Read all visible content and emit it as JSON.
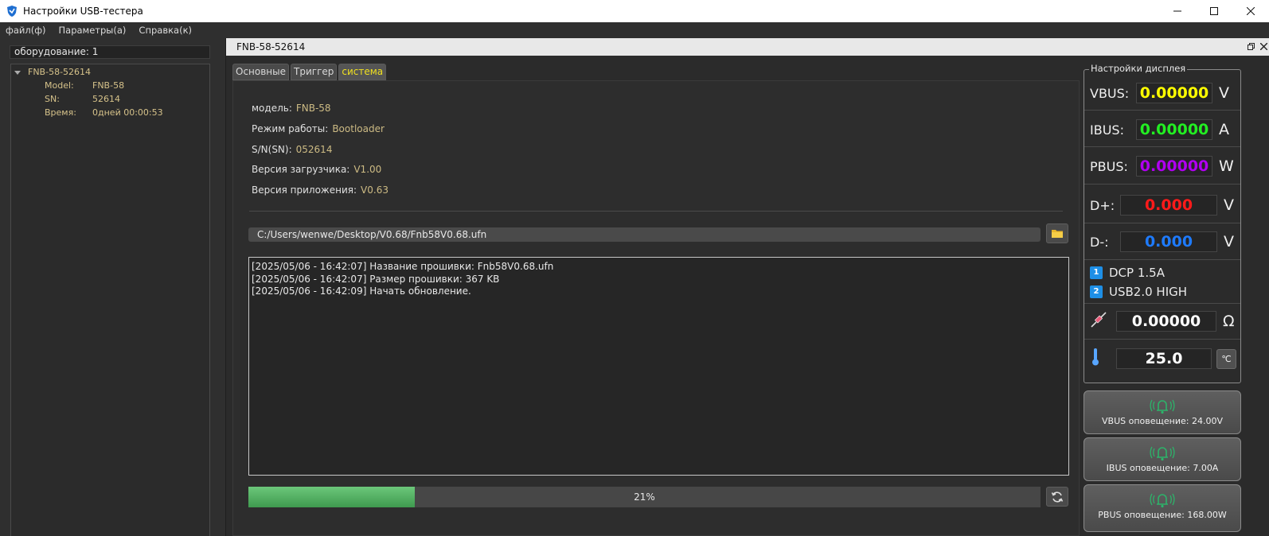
{
  "window": {
    "title": "Настройки USB-тестера"
  },
  "menu": [
    "файл(ф)",
    "Параметры(а)",
    "Справка(к)"
  ],
  "left": {
    "equipment_count": "оборудование: 1",
    "device": {
      "name": "FNB-58-52614",
      "rows": [
        {
          "k": "Model:",
          "v": "FNB-58"
        },
        {
          "k": "SN:",
          "v": "52614"
        },
        {
          "k": "Время:",
          "v": "0дней 00:00:53"
        }
      ]
    }
  },
  "center": {
    "header": "FNB-58-52614",
    "tabs": [
      "Основные",
      "Триггер",
      "система"
    ],
    "info": [
      {
        "k": "модель:",
        "v": "FNB-58"
      },
      {
        "k": "Режим работы:",
        "v": "Bootloader"
      },
      {
        "k": "S/N(SN):",
        "v": "052614"
      },
      {
        "k": "Версия загрузчика:",
        "v": "V1.00"
      },
      {
        "k": "Версия приложения:",
        "v": "V0.63"
      }
    ],
    "firmware_path": "C:/Users/wenwe/Desktop/V0.68/Fnb58V0.68.ufn",
    "log": [
      "[2025/05/06 - 16:42:07] Название прошивки: Fnb58V0.68.ufn",
      "[2025/05/06 - 16:42:07] Размер прошивки: 367 KB",
      "[2025/05/06 - 16:42:09] Начать обновление."
    ],
    "progress": {
      "value": 0.21,
      "label": "21%"
    }
  },
  "display": {
    "title": "Настройки дисплея",
    "measures": [
      {
        "label": "VBUS:",
        "value": "0.00000",
        "unit": "V",
        "color": "#ffff00"
      },
      {
        "label": "IBUS:",
        "value": "0.00000",
        "unit": "A",
        "color": "#22ee22"
      },
      {
        "label": "PBUS:",
        "value": "0.00000",
        "unit": "W",
        "color": "#b000f0"
      },
      {
        "label": "D+:",
        "value": "0.000",
        "unit": "V",
        "color": "#ff1a1a"
      },
      {
        "label": "D-:",
        "value": "0.000",
        "unit": "V",
        "color": "#1e7bff"
      }
    ],
    "modes": [
      {
        "num": "1",
        "text": "DCP 1.5A"
      },
      {
        "num": "2",
        "text": "USB2.0 HIGH"
      }
    ],
    "resistance": {
      "value": "0.00000",
      "unit": "Ω"
    },
    "temperature": {
      "value": "25.0",
      "unit": "℃"
    }
  },
  "alerts": [
    "VBUS оповещение: 24.00V",
    "IBUS оповещение: 7.00A",
    "PBUS оповещение: 168.00W"
  ],
  "colors": {
    "accent_tab": "#f0e020",
    "progress": "#4caf5c",
    "alert_bell": "#2db36a"
  }
}
